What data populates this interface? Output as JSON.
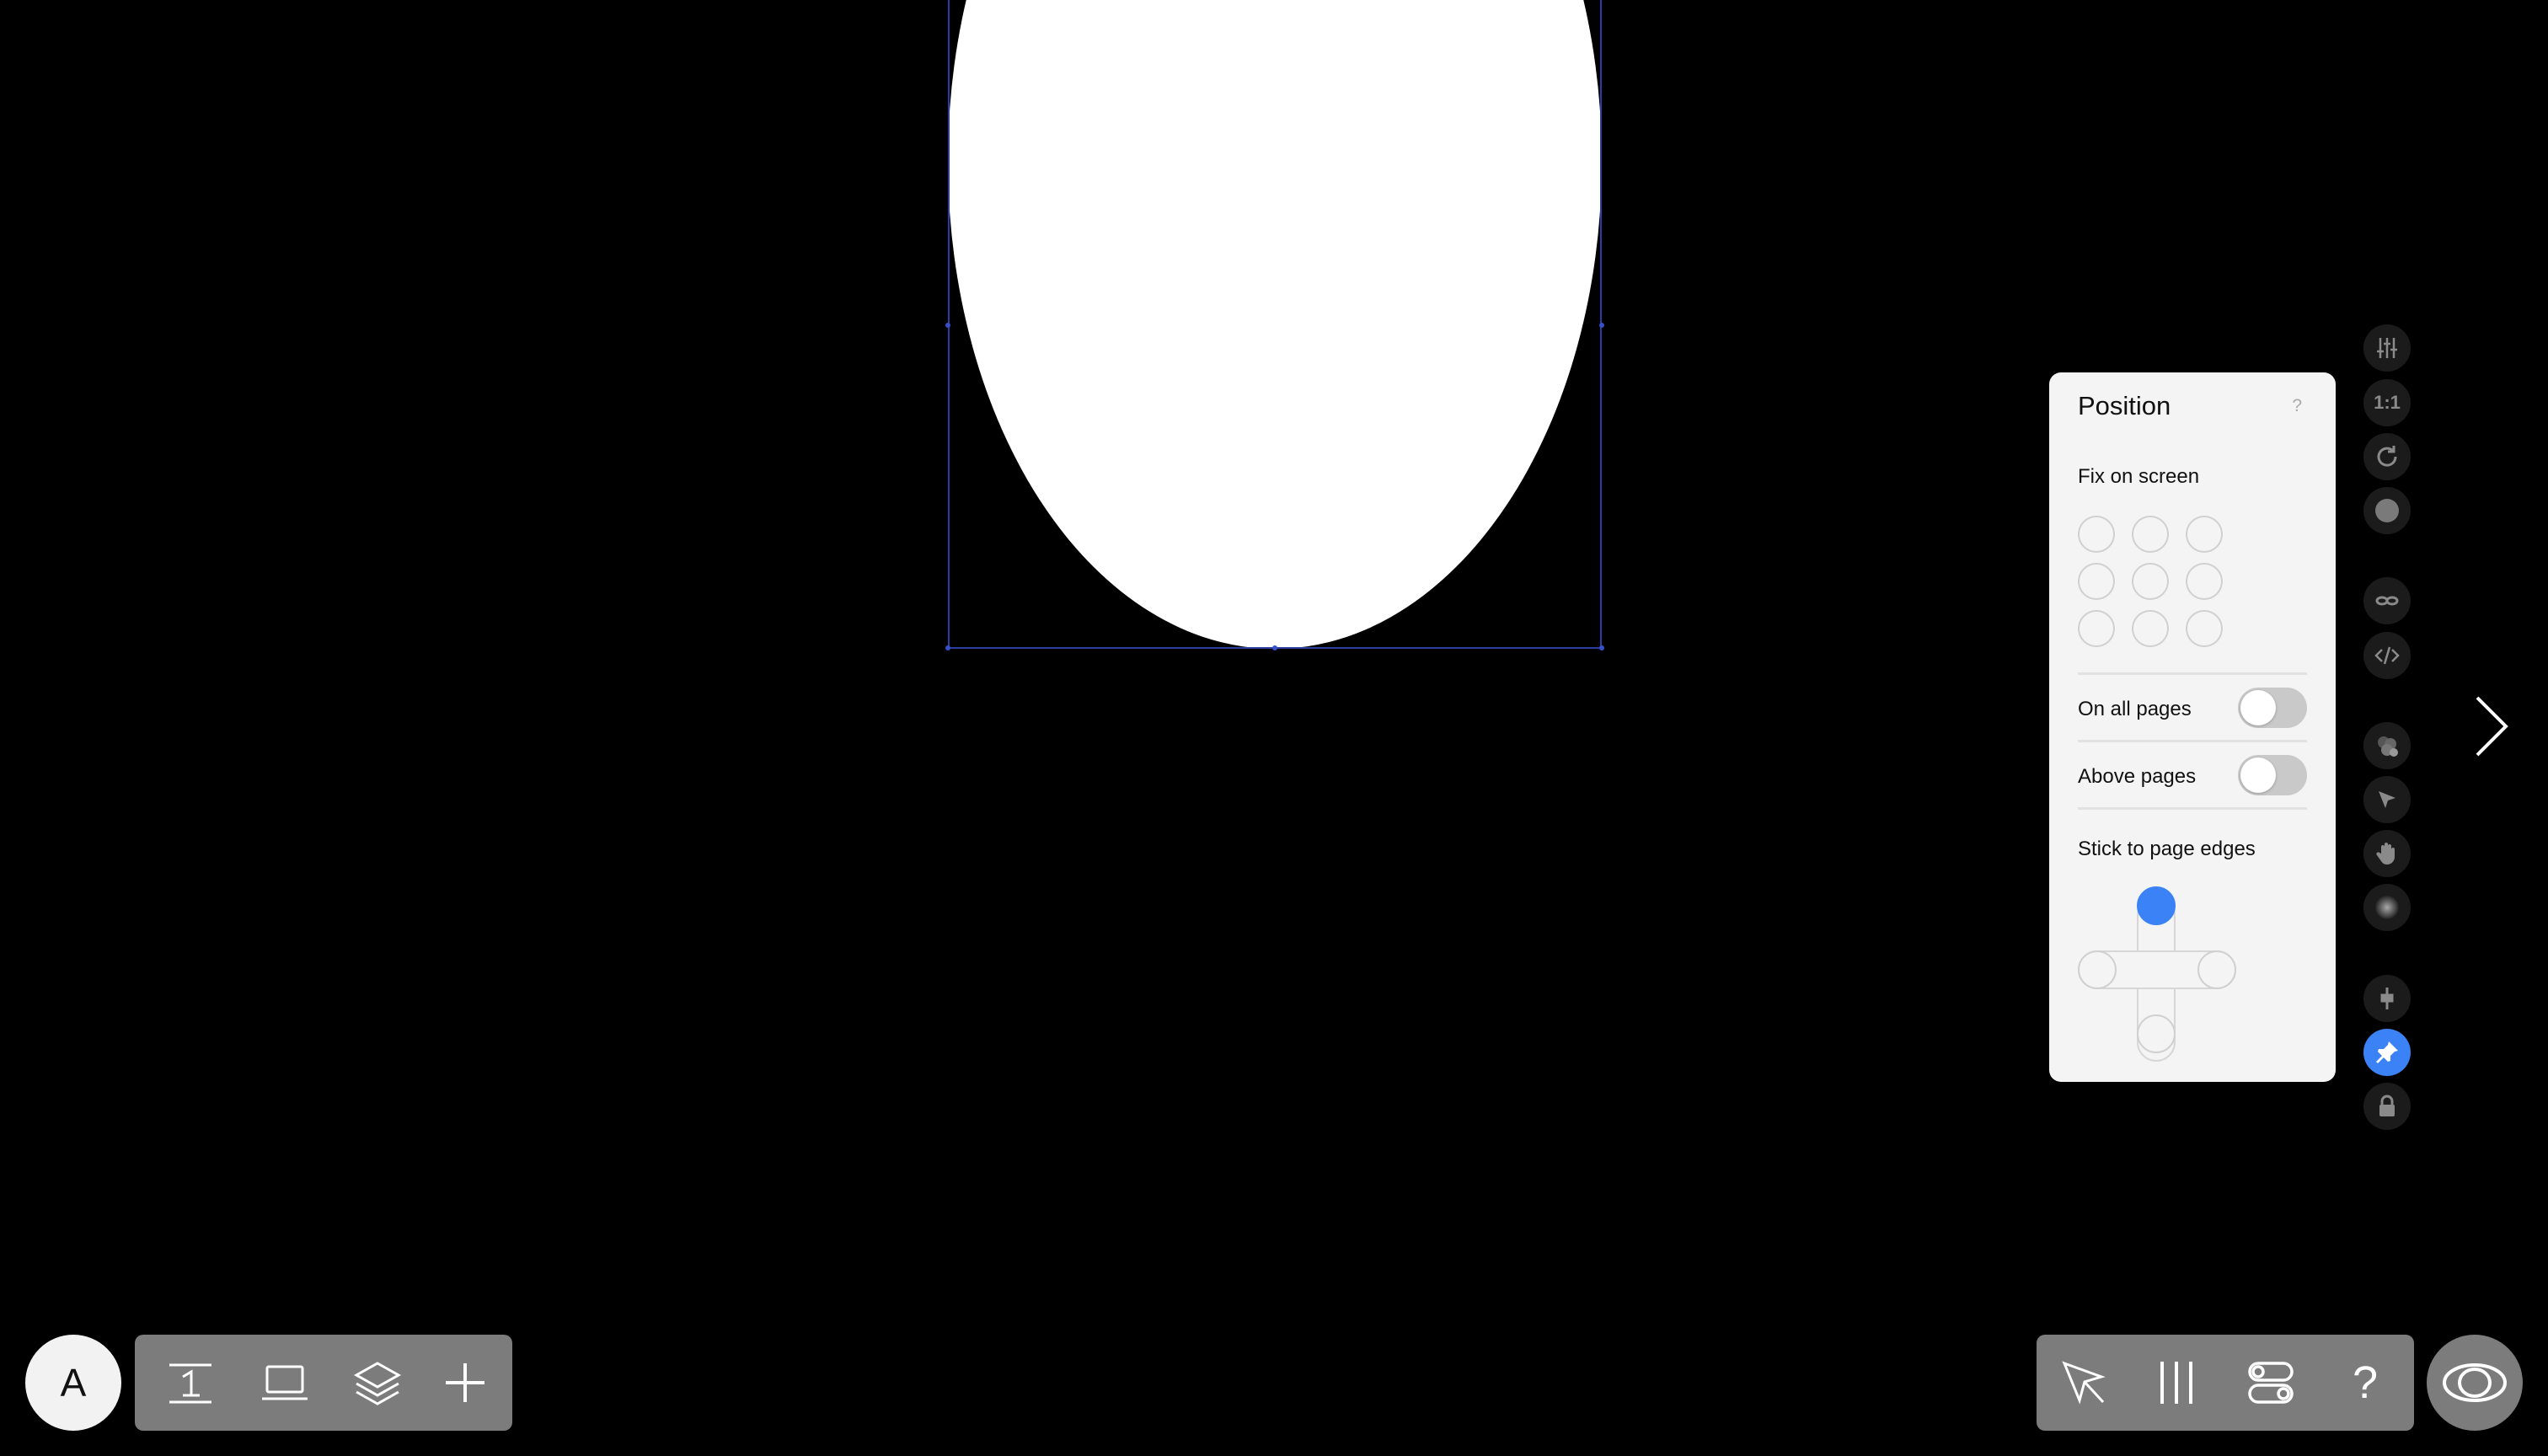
{
  "panel": {
    "title": "Position",
    "help": "?",
    "fix_on_screen": "Fix on screen",
    "on_all_pages": "On all pages",
    "above_pages": "Above pages",
    "stick_to_page_edges": "Stick to page edges"
  },
  "rail": {
    "ratio_label": "1:1"
  },
  "bottom": {
    "avatar_letter": "A",
    "help_label": "?"
  },
  "colors": {
    "accent": "#3b82f6",
    "panel_bg": "#f4f4f4",
    "toolbar_bg": "#7c7c7c"
  }
}
